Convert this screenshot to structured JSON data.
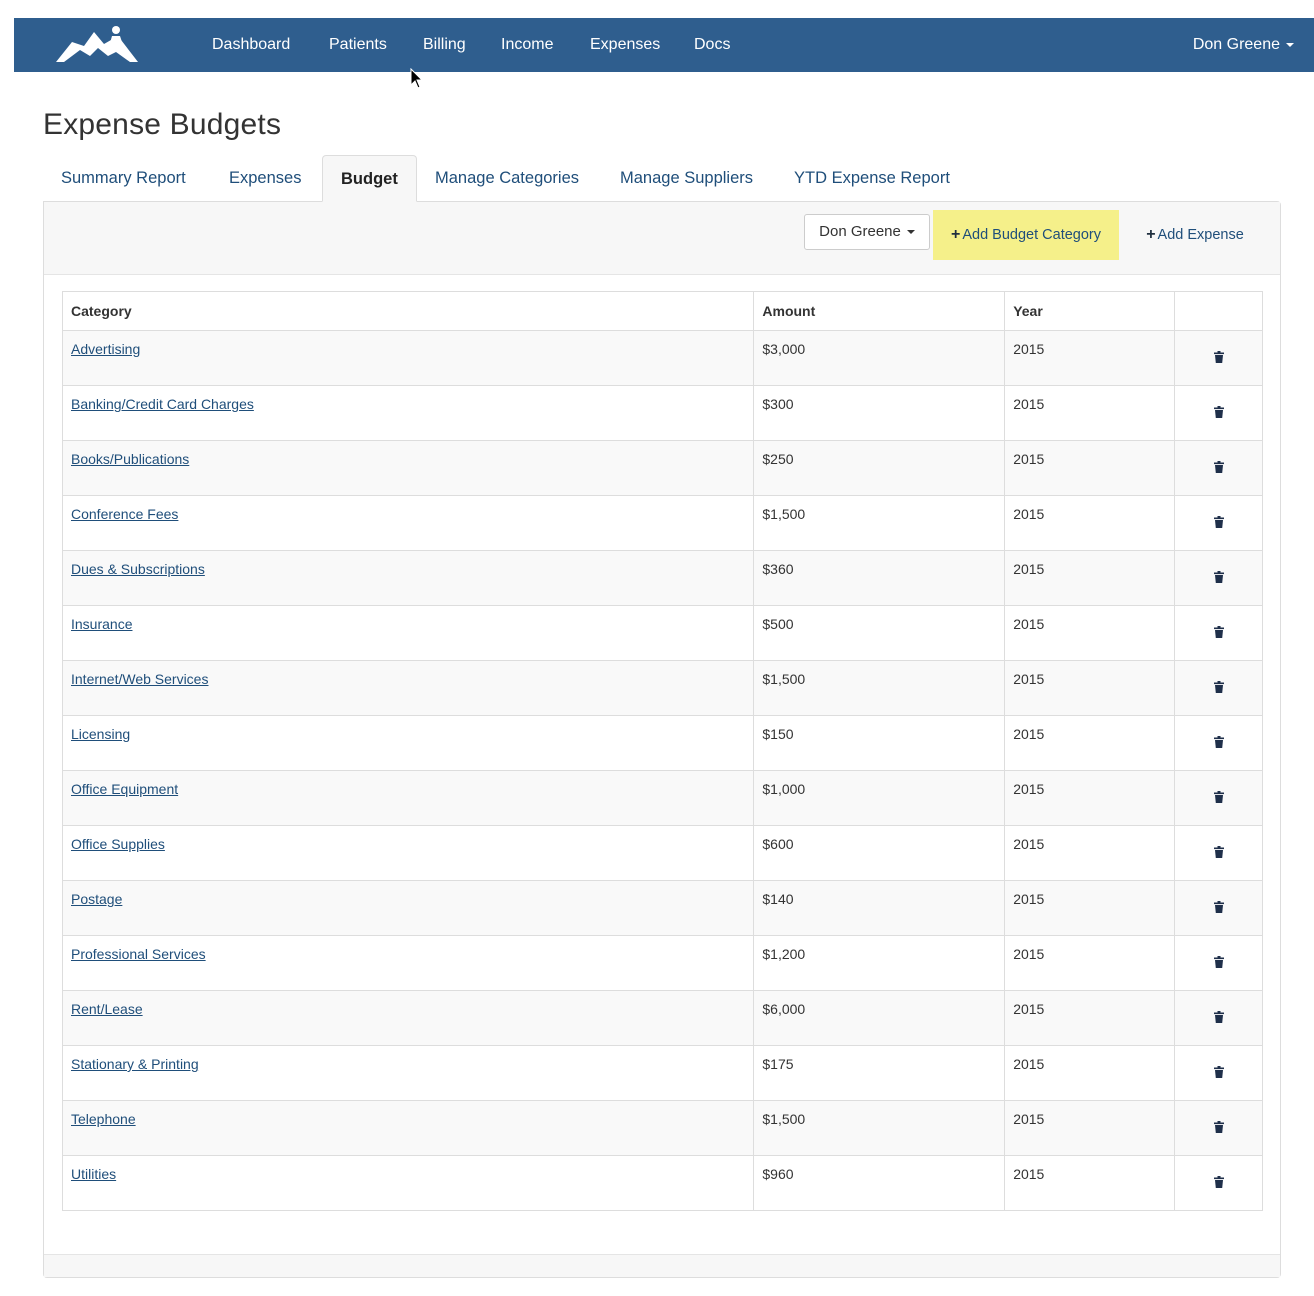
{
  "nav": {
    "items": [
      "Dashboard",
      "Patients",
      "Billing",
      "Income",
      "Expenses",
      "Docs"
    ],
    "user": "Don Greene"
  },
  "page": {
    "title": "Expense Budgets"
  },
  "tabs": [
    {
      "label": "Summary Report",
      "active": false
    },
    {
      "label": "Expenses",
      "active": false
    },
    {
      "label": "Budget",
      "active": true
    },
    {
      "label": "Manage Categories",
      "active": false
    },
    {
      "label": "Manage Suppliers",
      "active": false
    },
    {
      "label": "YTD Expense Report",
      "active": false
    }
  ],
  "toolbar": {
    "user_select": "Don Greene",
    "add_budget_label": "Add Budget Category",
    "add_expense_label": "Add Expense",
    "highlight_color": "#f5f08a"
  },
  "table": {
    "headers": [
      "Category",
      "Amount",
      "Year",
      ""
    ],
    "rows": [
      {
        "category": "Advertising",
        "amount": "$3,000",
        "year": "2015"
      },
      {
        "category": "Banking/Credit Card Charges",
        "amount": "$300",
        "year": "2015"
      },
      {
        "category": "Books/Publications",
        "amount": "$250",
        "year": "2015"
      },
      {
        "category": "Conference Fees",
        "amount": "$1,500",
        "year": "2015"
      },
      {
        "category": "Dues & Subscriptions",
        "amount": "$360",
        "year": "2015"
      },
      {
        "category": "Insurance",
        "amount": "$500",
        "year": "2015"
      },
      {
        "category": "Internet/Web Services",
        "amount": "$1,500",
        "year": "2015"
      },
      {
        "category": "Licensing",
        "amount": "$150",
        "year": "2015"
      },
      {
        "category": "Office Equipment",
        "amount": "$1,000",
        "year": "2015"
      },
      {
        "category": "Office Supplies",
        "amount": "$600",
        "year": "2015"
      },
      {
        "category": "Postage",
        "amount": "$140",
        "year": "2015"
      },
      {
        "category": "Professional Services",
        "amount": "$1,200",
        "year": "2015"
      },
      {
        "category": "Rent/Lease",
        "amount": "$6,000",
        "year": "2015"
      },
      {
        "category": "Stationary & Printing",
        "amount": "$175",
        "year": "2015"
      },
      {
        "category": "Telephone",
        "amount": "$1,500",
        "year": "2015"
      },
      {
        "category": "Utilities",
        "amount": "$960",
        "year": "2015"
      }
    ]
  },
  "colors": {
    "navbar": "#2f5e8e",
    "link": "#1f4e7a"
  },
  "icons": {
    "logo": "brand-logo",
    "row_action": "trash-icon",
    "user_menu": "caret-down-icon"
  }
}
